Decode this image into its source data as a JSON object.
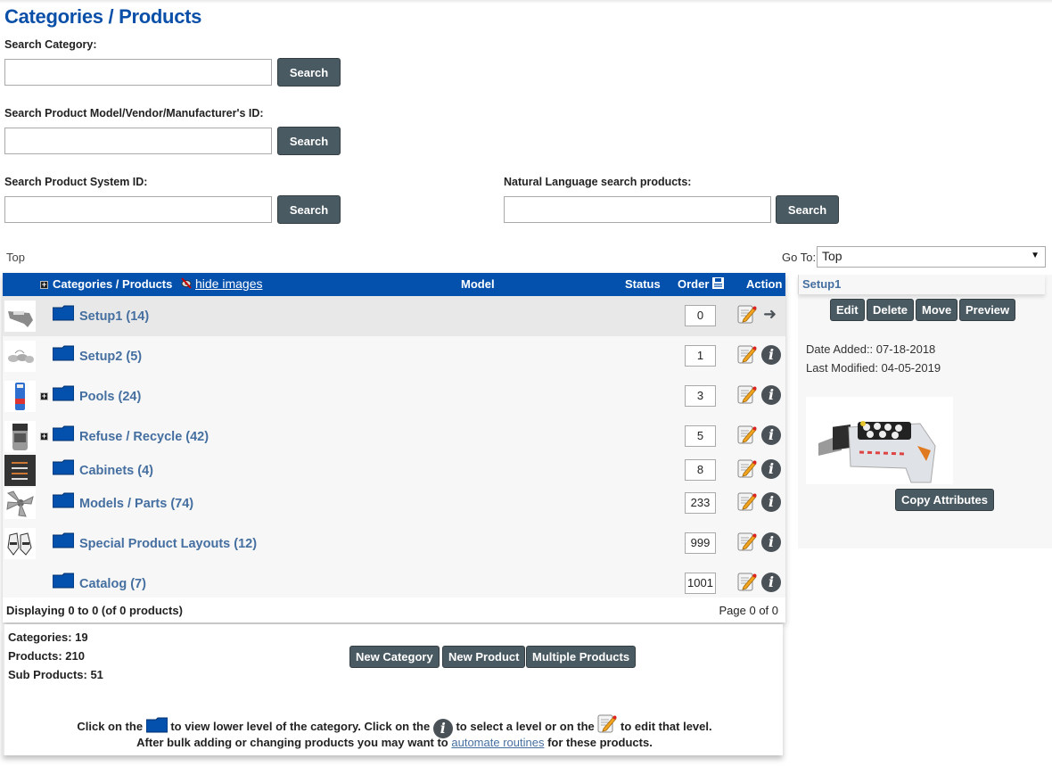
{
  "page": {
    "title": "Categories / Products"
  },
  "search": {
    "category": {
      "label": "Search Category:",
      "value": "",
      "placeholder": "",
      "button": "Search"
    },
    "model": {
      "label": "Search Product Model/Vendor/Manufacturer's ID:",
      "value": "",
      "placeholder": "",
      "button": "Search"
    },
    "system_id": {
      "label": "Search Product System ID:",
      "value": "",
      "placeholder": "",
      "button": "Search"
    },
    "natural": {
      "label": "Natural Language search products:",
      "value": "",
      "placeholder": "",
      "button": "Search"
    }
  },
  "breadcrumb": "Top",
  "goto": {
    "label": "Go To:",
    "selected": "Top"
  },
  "table": {
    "headers": {
      "name": "Categories / Products",
      "hide_images": "hide images",
      "model": "Model",
      "status": "Status",
      "order": "Order",
      "action": "Action"
    },
    "rows": [
      {
        "name": "Setup1 (14)",
        "order": "0",
        "expandable": false,
        "selected": true,
        "action": "arrow"
      },
      {
        "name": "Setup2 (5)",
        "order": "1",
        "expandable": false,
        "selected": false,
        "action": "info"
      },
      {
        "name": "Pools (24)",
        "order": "3",
        "expandable": true,
        "selected": false,
        "action": "info"
      },
      {
        "name": "Refuse / Recycle (42)",
        "order": "5",
        "expandable": true,
        "selected": false,
        "action": "info"
      },
      {
        "name": "Cabinets (4)",
        "order": "8",
        "expandable": false,
        "selected": false,
        "action": "info"
      },
      {
        "name": "Models / Parts (74)",
        "order": "233",
        "expandable": false,
        "selected": false,
        "action": "info"
      },
      {
        "name": "Special Product Layouts (12)",
        "order": "999",
        "expandable": false,
        "selected": false,
        "action": "info"
      },
      {
        "name": "Catalog (7)",
        "order": "1001",
        "expandable": false,
        "selected": false,
        "action": "info"
      }
    ],
    "footer": {
      "displaying": "Displaying 0 to 0 (of 0 products)",
      "page": "Page 0 of 0"
    }
  },
  "side_panel": {
    "title": "Setup1",
    "buttons": [
      "Edit",
      "Delete",
      "Move",
      "Preview"
    ],
    "date_added": "Date Added:: 07-18-2018",
    "last_modified": "Last Modified: 04-05-2019",
    "copy_button": "Copy Attributes"
  },
  "stats": {
    "categories": "Categories: 19",
    "products": "Products: 210",
    "sub_products": "Sub Products:  51"
  },
  "actions": {
    "new_category": "New Category",
    "new_product": "New Product",
    "multiple_products": "Multiple Products"
  },
  "help": {
    "part1": "Click on the",
    "part2": "to view lower level of the category. Click on the",
    "part3": "to select a level or on the",
    "part4": "to edit that level.",
    "line2_pre": "After bulk adding or changing products you may want to",
    "line2_link": "automate routines",
    "line2_post": "for these products."
  },
  "colors": {
    "brand_blue": "#0451ad",
    "link_blue": "#456fa0",
    "button_gray": "#4a5a62"
  }
}
